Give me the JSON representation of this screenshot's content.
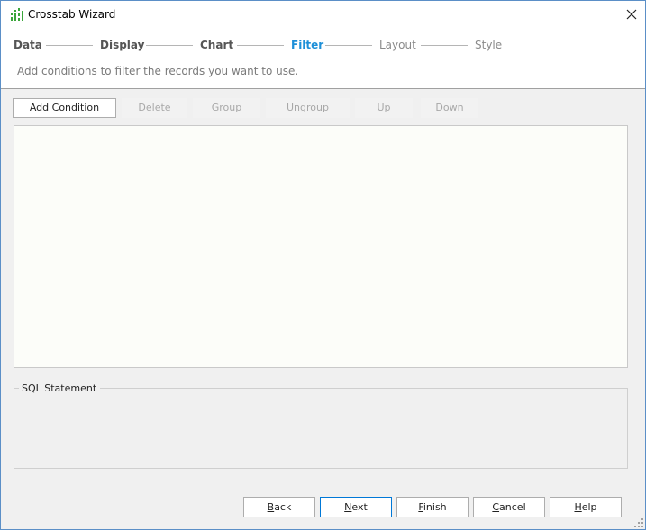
{
  "window": {
    "title": "Crosstab Wizard"
  },
  "steps": [
    {
      "label": "Data",
      "state": "done"
    },
    {
      "label": "Display",
      "state": "done"
    },
    {
      "label": "Chart",
      "state": "done"
    },
    {
      "label": "Filter",
      "state": "active"
    },
    {
      "label": "Layout",
      "state": "future"
    },
    {
      "label": "Style",
      "state": "future"
    }
  ],
  "subtitle": "Add conditions to filter the records you want to use.",
  "toolbar": {
    "add_condition": "Add Condition",
    "delete": "Delete",
    "group": "Group",
    "ungroup": "Ungroup",
    "up": "Up",
    "down": "Down"
  },
  "sql": {
    "legend": "SQL Statement",
    "value": ""
  },
  "footer": {
    "back": {
      "mnemonic": "B",
      "rest": "ack"
    },
    "next": {
      "mnemonic": "N",
      "rest": "ext"
    },
    "finish": {
      "mnemonic": "F",
      "rest": "inish"
    },
    "cancel": {
      "mnemonic": "C",
      "rest": "ancel"
    },
    "help": {
      "mnemonic": "H",
      "rest": "elp"
    }
  },
  "colors": {
    "active_step": "#1e90d8",
    "app_icon_green": "#3aa63a",
    "window_border": "#5b8fc7",
    "default_button_border": "#0078d7"
  },
  "icons": {
    "app": "crosstab-bars-icon",
    "close": "close-x-icon"
  }
}
